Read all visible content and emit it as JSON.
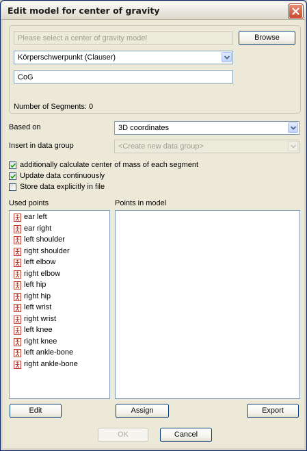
{
  "window": {
    "title": "Edit model for center of gravity"
  },
  "model": {
    "path_placeholder": "Please select a center of gravity model",
    "browse_label": "Browse",
    "selected_model": "Körperschwerpunkt (Clauser)",
    "name_value": "CoG",
    "segments_text": "Number of Segments: 0"
  },
  "options": {
    "based_on_label": "Based on",
    "based_on_value": "3D coordinates",
    "insert_label": "Insert in data group",
    "insert_value": "<Create new data group>"
  },
  "checkboxes": [
    {
      "label": "additionally calculate center of mass of each segment",
      "checked": true
    },
    {
      "label": "Update data continuously",
      "checked": true
    },
    {
      "label": "Store data explicitly in file",
      "checked": false
    }
  ],
  "used_points": {
    "header": "Used points",
    "items": [
      "ear left",
      "ear right",
      "left shoulder",
      "right shoulder",
      "left elbow",
      "right elbow",
      "left hip",
      "right hip",
      "left wrist",
      "right wrist",
      "left knee",
      "right knee",
      "left ankle-bone",
      "right ankle-bone"
    ]
  },
  "model_points": {
    "header": "Points in model",
    "items": []
  },
  "buttons": {
    "edit": "Edit",
    "assign": "Assign",
    "export": "Export",
    "ok": "OK",
    "cancel": "Cancel"
  },
  "icons": {
    "close": "close-icon",
    "point": "person-point-icon",
    "dropdown": "chevron-down-icon",
    "check": "checkmark-icon"
  },
  "colors": {
    "title_close": "#c94a2a",
    "field_border": "#7f9db9",
    "button_border": "#003c74",
    "point_icon": "#c0392b"
  }
}
